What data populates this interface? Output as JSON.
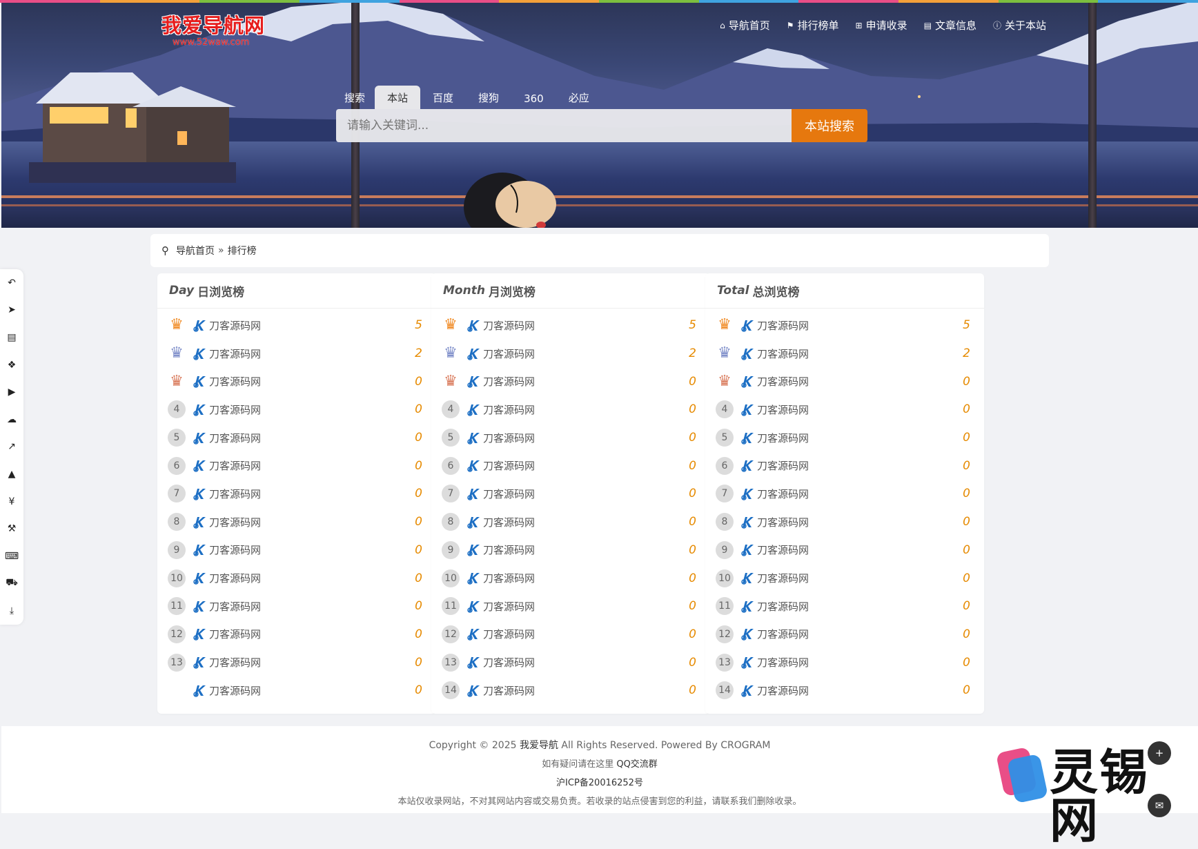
{
  "colors": {
    "accent": "#e6780e",
    "count": "#e68a00",
    "logo": "#e61d1d",
    "rainbow": [
      "#e94e87",
      "#f3a03a",
      "#7cbf3f",
      "#3fa3e0",
      "#e94e87",
      "#f3a03a",
      "#7cbf3f",
      "#3fa3e0",
      "#e94e87",
      "#f3a03a",
      "#7cbf3f",
      "#3fa3e0"
    ]
  },
  "logo": {
    "title": "我爱导航网",
    "url": "www.52waw.com"
  },
  "nav": [
    {
      "label": "导航首页",
      "icon": "home-icon"
    },
    {
      "label": "排行榜单",
      "icon": "flag-icon"
    },
    {
      "label": "申请收录",
      "icon": "plus-square-icon"
    },
    {
      "label": "文章信息",
      "icon": "book-icon"
    },
    {
      "label": "关于本站",
      "icon": "info-circle-icon"
    }
  ],
  "search": {
    "tabs": [
      "搜索",
      "本站",
      "百度",
      "搜狗",
      "360",
      "必应"
    ],
    "active_tab": "本站",
    "placeholder": "请输入关键词...",
    "button": "本站搜索"
  },
  "sidebar": [
    "back-icon",
    "paper-plane-icon",
    "file-icon",
    "cubes-icon",
    "youtube-icon",
    "cloud-icon",
    "line-chart-icon",
    "graduation-cap-icon",
    "yen-icon",
    "wrench-icon",
    "keyboard-icon",
    "cart-icon",
    "download-icon"
  ],
  "breadcrumb": {
    "home": "导航首页",
    "sep": "»",
    "current": "排行榜"
  },
  "panels": [
    {
      "en": "Day",
      "cn": "日浏览榜",
      "rows": [
        {
          "rank": "1",
          "name": "刀客源码网",
          "count": "5"
        },
        {
          "rank": "2",
          "name": "刀客源码网",
          "count": "2"
        },
        {
          "rank": "3",
          "name": "刀客源码网",
          "count": "0"
        },
        {
          "rank": "4",
          "name": "刀客源码网",
          "count": "0"
        },
        {
          "rank": "5",
          "name": "刀客源码网",
          "count": "0"
        },
        {
          "rank": "6",
          "name": "刀客源码网",
          "count": "0"
        },
        {
          "rank": "7",
          "name": "刀客源码网",
          "count": "0"
        },
        {
          "rank": "8",
          "name": "刀客源码网",
          "count": "0"
        },
        {
          "rank": "9",
          "name": "刀客源码网",
          "count": "0"
        },
        {
          "rank": "10",
          "name": "刀客源码网",
          "count": "0"
        },
        {
          "rank": "11",
          "name": "刀客源码网",
          "count": "0"
        },
        {
          "rank": "12",
          "name": "刀客源码网",
          "count": "0"
        },
        {
          "rank": "13",
          "name": "刀客源码网",
          "count": "0"
        },
        {
          "rank": "",
          "name": "刀客源码网",
          "count": "0"
        }
      ]
    },
    {
      "en": "Month",
      "cn": "月浏览榜",
      "rows": [
        {
          "rank": "1",
          "name": "刀客源码网",
          "count": "5"
        },
        {
          "rank": "2",
          "name": "刀客源码网",
          "count": "2"
        },
        {
          "rank": "3",
          "name": "刀客源码网",
          "count": "0"
        },
        {
          "rank": "4",
          "name": "刀客源码网",
          "count": "0"
        },
        {
          "rank": "5",
          "name": "刀客源码网",
          "count": "0"
        },
        {
          "rank": "6",
          "name": "刀客源码网",
          "count": "0"
        },
        {
          "rank": "7",
          "name": "刀客源码网",
          "count": "0"
        },
        {
          "rank": "8",
          "name": "刀客源码网",
          "count": "0"
        },
        {
          "rank": "9",
          "name": "刀客源码网",
          "count": "0"
        },
        {
          "rank": "10",
          "name": "刀客源码网",
          "count": "0"
        },
        {
          "rank": "11",
          "name": "刀客源码网",
          "count": "0"
        },
        {
          "rank": "12",
          "name": "刀客源码网",
          "count": "0"
        },
        {
          "rank": "13",
          "name": "刀客源码网",
          "count": "0"
        },
        {
          "rank": "14",
          "name": "刀客源码网",
          "count": "0"
        }
      ]
    },
    {
      "en": "Total",
      "cn": "总浏览榜",
      "rows": [
        {
          "rank": "1",
          "name": "刀客源码网",
          "count": "5"
        },
        {
          "rank": "2",
          "name": "刀客源码网",
          "count": "2"
        },
        {
          "rank": "3",
          "name": "刀客源码网",
          "count": "0"
        },
        {
          "rank": "4",
          "name": "刀客源码网",
          "count": "0"
        },
        {
          "rank": "5",
          "name": "刀客源码网",
          "count": "0"
        },
        {
          "rank": "6",
          "name": "刀客源码网",
          "count": "0"
        },
        {
          "rank": "7",
          "name": "刀客源码网",
          "count": "0"
        },
        {
          "rank": "8",
          "name": "刀客源码网",
          "count": "0"
        },
        {
          "rank": "9",
          "name": "刀客源码网",
          "count": "0"
        },
        {
          "rank": "10",
          "name": "刀客源码网",
          "count": "0"
        },
        {
          "rank": "11",
          "name": "刀客源码网",
          "count": "0"
        },
        {
          "rank": "12",
          "name": "刀客源码网",
          "count": "0"
        },
        {
          "rank": "13",
          "name": "刀客源码网",
          "count": "0"
        },
        {
          "rank": "14",
          "name": "刀客源码网",
          "count": "0"
        }
      ]
    }
  ],
  "footer": {
    "copyright_pre": "Copyright © 2025",
    "site": "我爱导航",
    "copyright_post": "All Rights Reserved. Powered By CROGRAM",
    "question": "如有疑问请在这里",
    "qq": "QQ交流群",
    "icp": "沪ICP备20016252号",
    "disclaimer": "本站仅收录网站，不对其网站内容或交易负责。若收录的站点侵害到您的利益，请联系我们删除收录。"
  },
  "watermark": "灵锡网"
}
